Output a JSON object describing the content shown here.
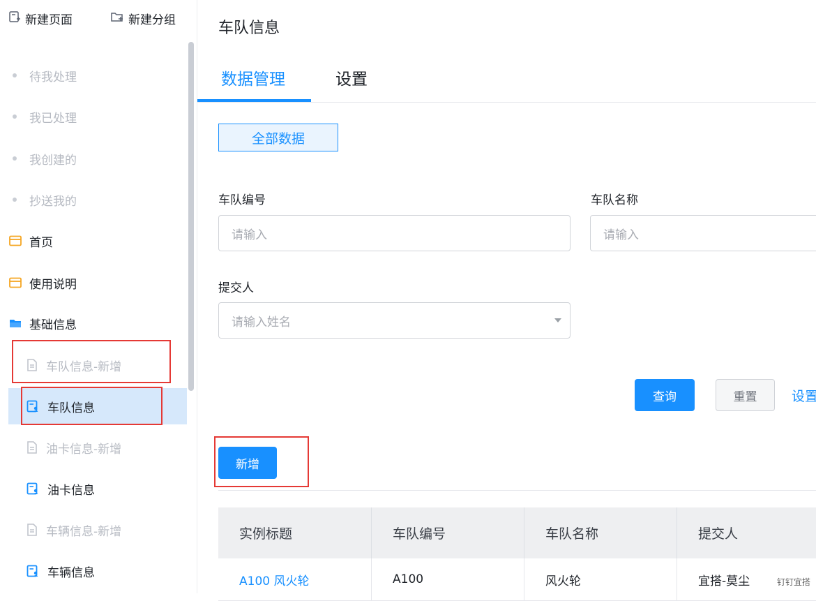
{
  "sidebar": {
    "actions": {
      "new_page": "新建页面",
      "new_group": "新建分组"
    },
    "items": [
      {
        "label": "待我处理"
      },
      {
        "label": "我已处理"
      },
      {
        "label": "我创建的"
      },
      {
        "label": "抄送我的"
      },
      {
        "label": "首页"
      },
      {
        "label": "使用说明"
      },
      {
        "label": "基础信息"
      },
      {
        "label": "车队信息-新增"
      },
      {
        "label": "车队信息"
      },
      {
        "label": "油卡信息-新增"
      },
      {
        "label": "油卡信息"
      },
      {
        "label": "车辆信息-新增"
      },
      {
        "label": "车辆信息"
      }
    ]
  },
  "main": {
    "title": "车队信息",
    "tabs": [
      {
        "label": "数据管理"
      },
      {
        "label": "设置"
      }
    ],
    "filter_tab": "全部数据",
    "form": {
      "team_no": {
        "label": "车队编号",
        "placeholder": "请输入"
      },
      "team_name": {
        "label": "车队名称",
        "placeholder": "请输入"
      },
      "submitter": {
        "label": "提交人",
        "placeholder": "请输入姓名"
      }
    },
    "buttons": {
      "query": "查询",
      "reset": "重置",
      "settings": "设置",
      "add": "新增"
    },
    "table": {
      "columns": [
        "实例标题",
        "车队编号",
        "车队名称",
        "提交人"
      ],
      "rows": [
        [
          "A100 风火轮",
          "A100",
          "风火轮",
          "宜搭-莫尘"
        ]
      ]
    }
  },
  "watermark": "钉钉宜搭",
  "colors": {
    "accent": "#1890ff",
    "highlight": "#e53935"
  }
}
